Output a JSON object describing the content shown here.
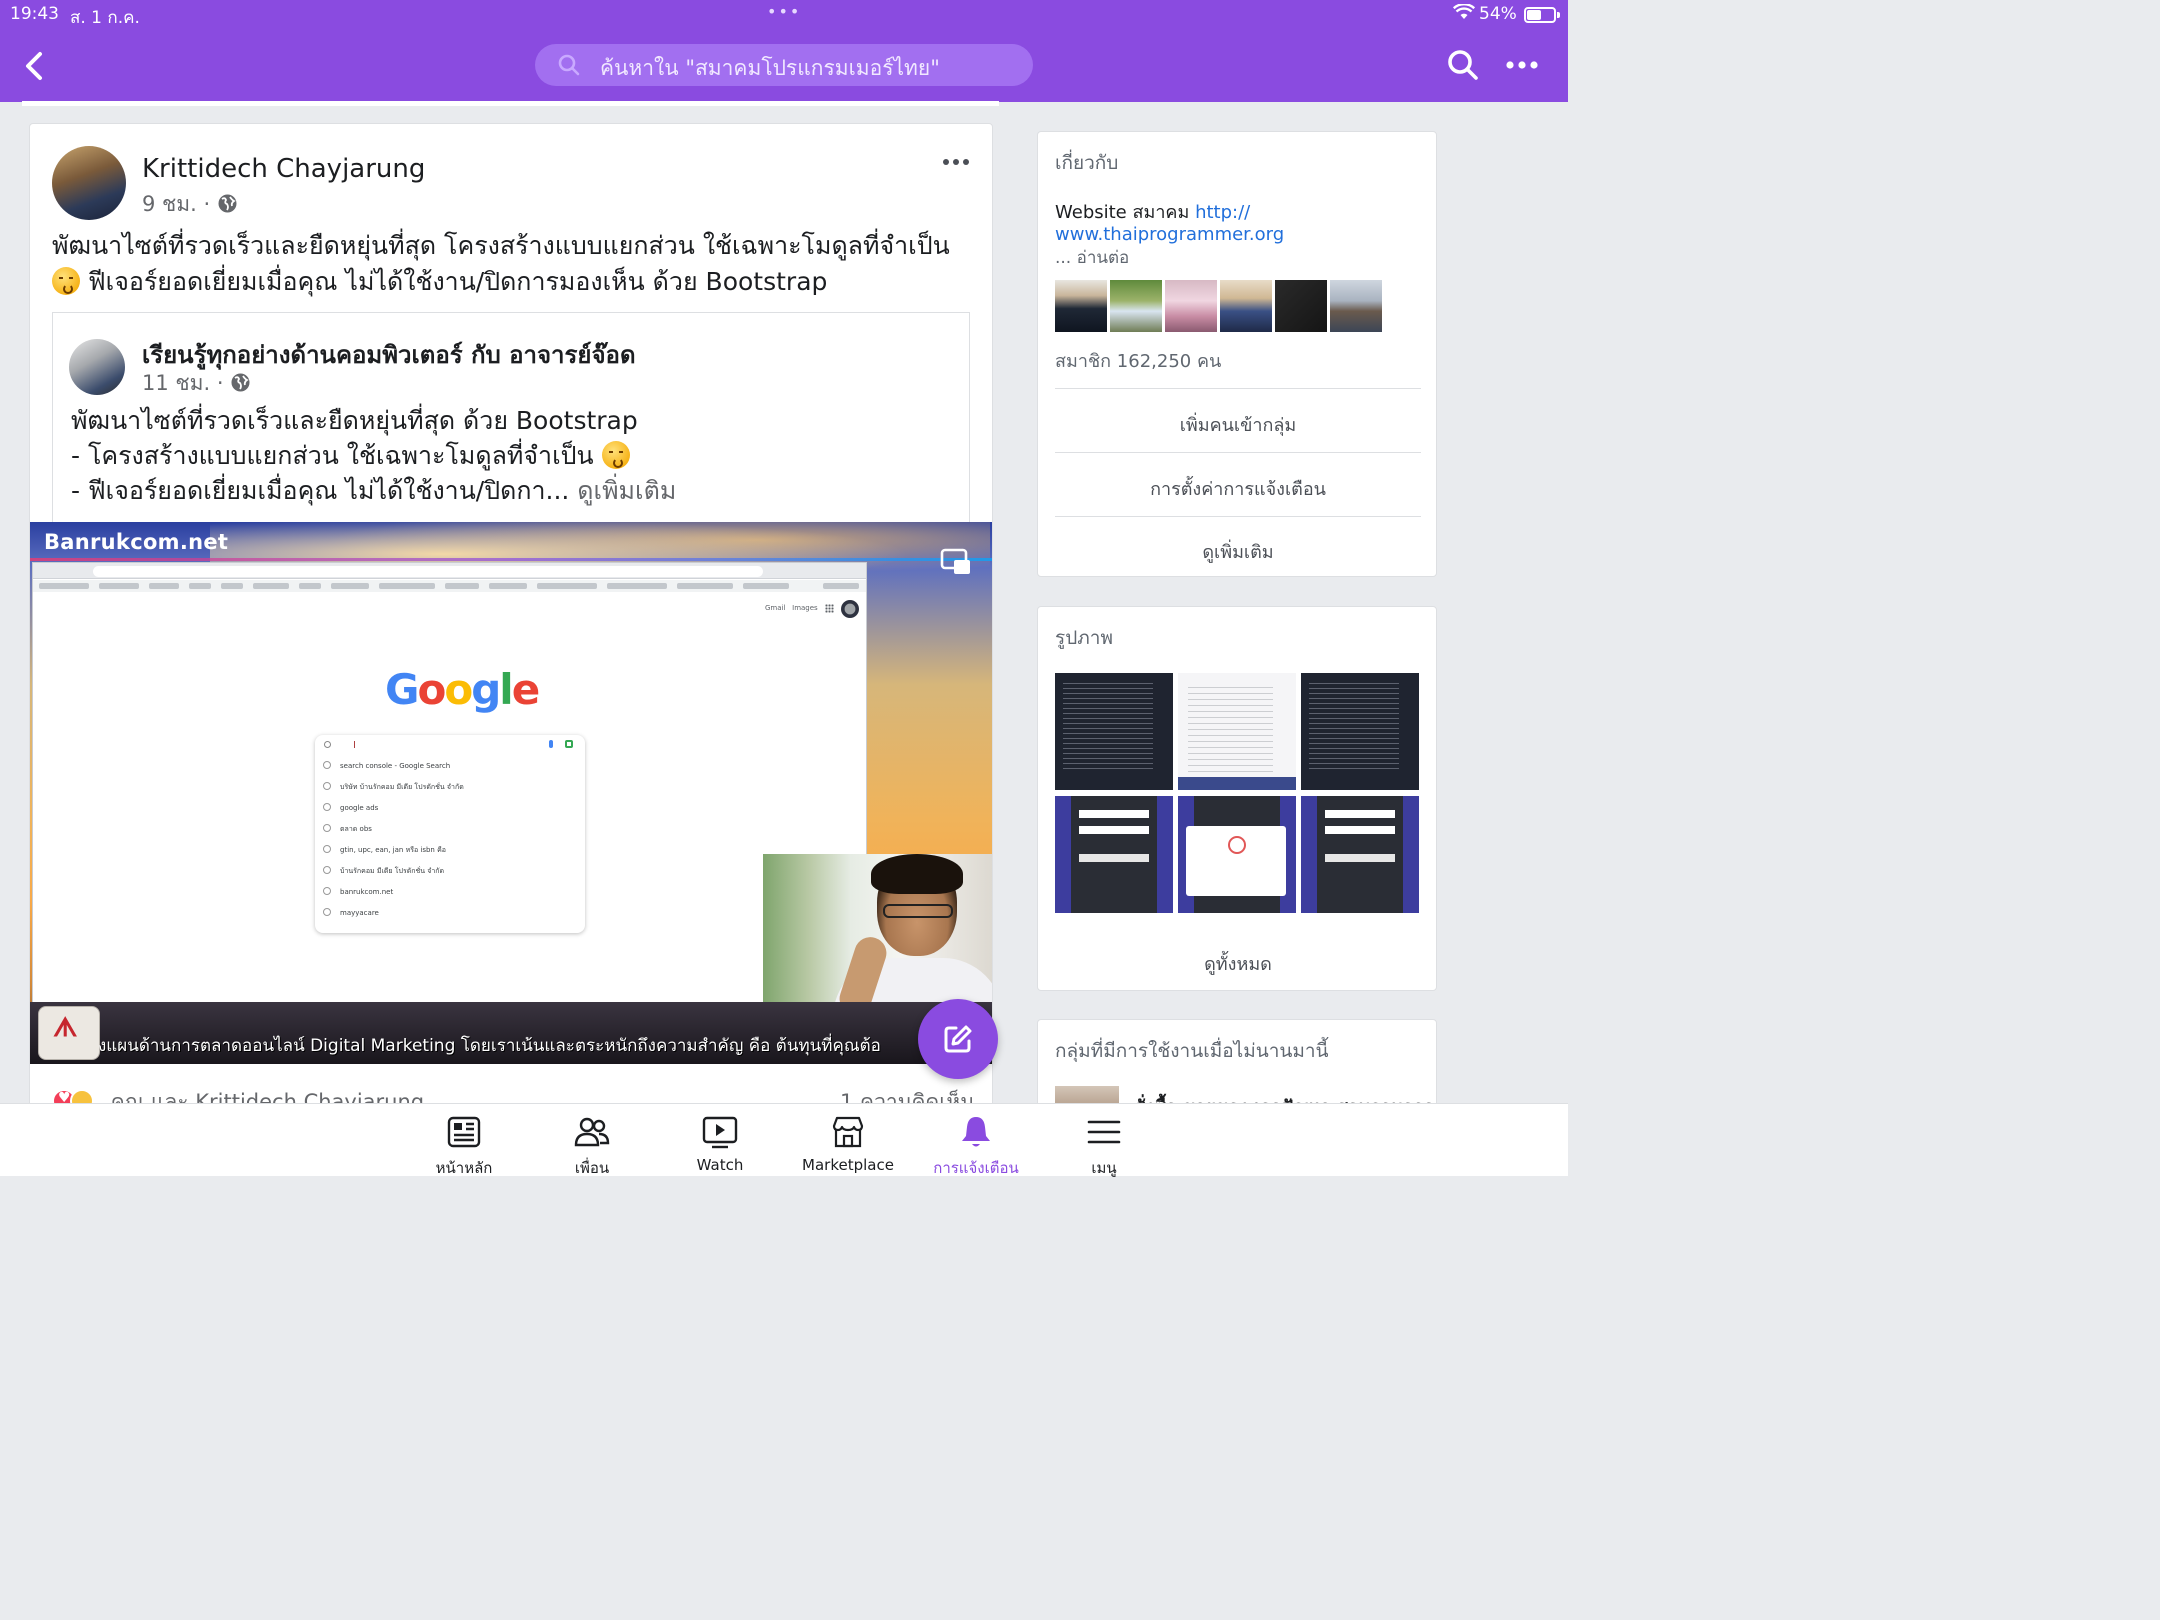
{
  "status_bar": {
    "time": "19:43",
    "date": "ส. 1 ก.ค.",
    "battery": "54%",
    "battery_level": 0.54
  },
  "header": {
    "search_placeholder": "ค้นหาใน \"สมาคมโปรแกรมเมอร์ไทย\""
  },
  "post": {
    "author": "Krittidech Chayjarung",
    "time": "9 ชม.",
    "separator": "·",
    "text_line1": "พัฒนาไซต์ที่รวดเร็วและยืดหยุ่นที่สุด โครงสร้างแบบแยกส่วน ใช้เฉพาะโมดูลที่จำเป็น",
    "text_line2": "ฟีเจอร์ยอดเยี่ยมเมื่อคุณ ไม่ได้ใช้งาน/ปิดการมองเห็น ด้วย Bootstrap",
    "shared": {
      "author": "เรียนรู้ทุกอย่างด้านคอมพิวเตอร์ กับ อาจารย์จ๊อด",
      "time": "11 ชม.",
      "line1": "พัฒนาไซต์ที่รวดเร็วและยืดหยุ่นที่สุด ด้วย Bootstrap",
      "line2": "- โครงสร้างแบบแยกส่วน ใช้เฉพาะโมดูลที่จำเป็น",
      "line3": "- ฟีเจอร์ยอดเยี่ยมเมื่อคุณ ไม่ได้ใช้งาน/ปิดกา...",
      "see_more": "ดูเพิ่มเติม"
    },
    "video": {
      "brand": "Banrukcom.net",
      "ticker": "งแผนด้านการตลาดออนไลน์ Digital Marketing โดยเราเน้นและตระหนักถึงความสำคัญ คือ ต้นทุนที่คุณต้อ",
      "browser": {
        "gmail": "Gmail",
        "images": "Images",
        "suggestions": [
          "search console - Google Search",
          "บริษัท บ้านรักคอม มีเดีย โปรดักชั่น จำกัด",
          "google ads",
          "ตลาด obs",
          "gtin, upc, ean, jan หรือ isbn คือ",
          "บ้านรักคอม มีเดีย โปรดักชั่น จำกัด",
          "banrukcom.net",
          "mayyacare"
        ]
      }
    },
    "reactions_text": "คุณ และ Krittidech Chayjarung",
    "comments": "1 ความคิดเห็น"
  },
  "about": {
    "title": "เกี่ยวกับ",
    "desc_prefix": "Website สมาคม ",
    "desc_link1": "http://",
    "desc_link2": "www.thaiprogrammer.org",
    "read_more": "... อ่านต่อ",
    "members": "สมาชิก 162,250 คน",
    "add_members": "เพิ่มคนเข้ากลุ่ม",
    "notification_settings": "การตั้งค่าการแจ้งเตือน",
    "see_more": "ดูเพิ่มเติม"
  },
  "photos": {
    "title": "รูปภาพ",
    "see_all": "ดูทั้งหมด"
  },
  "recent_groups": {
    "title": "กลุ่มที่มีการใช้งานเมื่อไม่นานมานี้",
    "first_group": "สั่งซื้อ ขายของ เจอปัญหา สอบถามอาจารย์"
  },
  "tabs": [
    {
      "label": "หน้าหลัก",
      "icon": "newsfeed-icon"
    },
    {
      "label": "เพื่อน",
      "icon": "friends-icon"
    },
    {
      "label": "Watch",
      "icon": "watch-icon"
    },
    {
      "label": "Marketplace",
      "icon": "marketplace-icon"
    },
    {
      "label": "การแจ้งเตือน",
      "icon": "bell-icon"
    },
    {
      "label": "เมนู",
      "icon": "menu-icon"
    }
  ],
  "colors": {
    "brand": "#8a4be0",
    "link": "#216fdb"
  }
}
